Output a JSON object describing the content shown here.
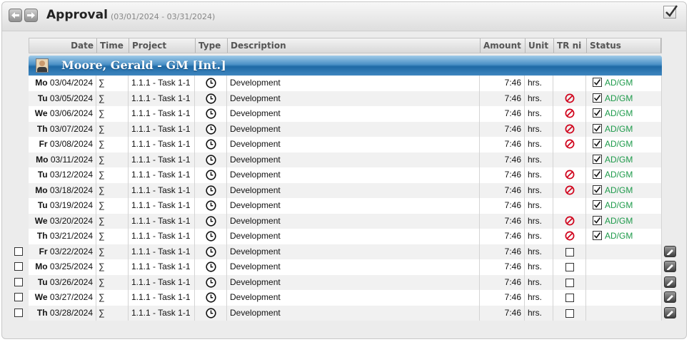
{
  "header": {
    "title": "Approval",
    "date_range": "(03/01/2024 - 03/31/2024)",
    "prev_icon": "arrow-left-icon",
    "next_icon": "arrow-right-icon",
    "approve_all_icon": "checkbox-checked-icon"
  },
  "columns": {
    "date": "Date",
    "time": "Time",
    "project": "Project",
    "type": "Type",
    "description": "Description",
    "amount": "Amount",
    "unit": "Unit",
    "tr": "TR ni",
    "status": "Status"
  },
  "employee": {
    "name": "Moore, Gerald - GM [Int.]",
    "avatar_icon": "person-avatar-icon"
  },
  "colors": {
    "status_text": "#1d9a4a",
    "no_icon": "#d0021b",
    "employee_bar": "#1f6aa6"
  },
  "rows": [
    {
      "day": "Mo",
      "date": "03/04/2024",
      "time": "∑",
      "project": "1.1.1 - Task 1-1",
      "type_icon": "clock-icon",
      "description": "Development",
      "amount": "7:46",
      "unit": "hrs.",
      "tr": "",
      "status": "AD/GM",
      "approved": true
    },
    {
      "day": "Tu",
      "date": "03/05/2024",
      "time": "∑",
      "project": "1.1.1 - Task 1-1",
      "type_icon": "clock-icon",
      "description": "Development",
      "amount": "7:46",
      "unit": "hrs.",
      "tr": "no",
      "status": "AD/GM",
      "approved": true
    },
    {
      "day": "We",
      "date": "03/06/2024",
      "time": "∑",
      "project": "1.1.1 - Task 1-1",
      "type_icon": "clock-icon",
      "description": "Development",
      "amount": "7:46",
      "unit": "hrs.",
      "tr": "no",
      "status": "AD/GM",
      "approved": true
    },
    {
      "day": "Th",
      "date": "03/07/2024",
      "time": "∑",
      "project": "1.1.1 - Task 1-1",
      "type_icon": "clock-icon",
      "description": "Development",
      "amount": "7:46",
      "unit": "hrs.",
      "tr": "no",
      "status": "AD/GM",
      "approved": true
    },
    {
      "day": "Fr",
      "date": "03/08/2024",
      "time": "∑",
      "project": "1.1.1 - Task 1-1",
      "type_icon": "clock-icon",
      "description": "Development",
      "amount": "7:46",
      "unit": "hrs.",
      "tr": "no",
      "status": "AD/GM",
      "approved": true
    },
    {
      "day": "Mo",
      "date": "03/11/2024",
      "time": "∑",
      "project": "1.1.1 - Task 1-1",
      "type_icon": "clock-icon",
      "description": "Development",
      "amount": "7:46",
      "unit": "hrs.",
      "tr": "",
      "status": "AD/GM",
      "approved": true
    },
    {
      "day": "Tu",
      "date": "03/12/2024",
      "time": "∑",
      "project": "1.1.1 - Task 1-1",
      "type_icon": "clock-icon",
      "description": "Development",
      "amount": "7:46",
      "unit": "hrs.",
      "tr": "no",
      "status": "AD/GM",
      "approved": true
    },
    {
      "day": "Mo",
      "date": "03/18/2024",
      "time": "∑",
      "project": "1.1.1 - Task 1-1",
      "type_icon": "clock-icon",
      "description": "Development",
      "amount": "7:46",
      "unit": "hrs.",
      "tr": "no",
      "status": "AD/GM",
      "approved": true
    },
    {
      "day": "Tu",
      "date": "03/19/2024",
      "time": "∑",
      "project": "1.1.1 - Task 1-1",
      "type_icon": "clock-icon",
      "description": "Development",
      "amount": "7:46",
      "unit": "hrs.",
      "tr": "",
      "status": "AD/GM",
      "approved": true
    },
    {
      "day": "We",
      "date": "03/20/2024",
      "time": "∑",
      "project": "1.1.1 - Task 1-1",
      "type_icon": "clock-icon",
      "description": "Development",
      "amount": "7:46",
      "unit": "hrs.",
      "tr": "no",
      "status": "AD/GM",
      "approved": true
    },
    {
      "day": "Th",
      "date": "03/21/2024",
      "time": "∑",
      "project": "1.1.1 - Task 1-1",
      "type_icon": "clock-icon",
      "description": "Development",
      "amount": "7:46",
      "unit": "hrs.",
      "tr": "no",
      "status": "AD/GM",
      "approved": true
    },
    {
      "day": "Fr",
      "date": "03/22/2024",
      "time": "∑",
      "project": "1.1.1 - Task 1-1",
      "type_icon": "clock-icon",
      "description": "Development",
      "amount": "7:46",
      "unit": "hrs.",
      "tr": "checkbox",
      "status": "",
      "approved": false
    },
    {
      "day": "Mo",
      "date": "03/25/2024",
      "time": "∑",
      "project": "1.1.1 - Task 1-1",
      "type_icon": "clock-icon",
      "description": "Development",
      "amount": "7:46",
      "unit": "hrs.",
      "tr": "checkbox",
      "status": "",
      "approved": false
    },
    {
      "day": "Tu",
      "date": "03/26/2024",
      "time": "∑",
      "project": "1.1.1 - Task 1-1",
      "type_icon": "clock-icon",
      "description": "Development",
      "amount": "7:46",
      "unit": "hrs.",
      "tr": "checkbox",
      "status": "",
      "approved": false
    },
    {
      "day": "We",
      "date": "03/27/2024",
      "time": "∑",
      "project": "1.1.1 - Task 1-1",
      "type_icon": "clock-icon",
      "description": "Development",
      "amount": "7:46",
      "unit": "hrs.",
      "tr": "checkbox",
      "status": "",
      "approved": false
    },
    {
      "day": "Th",
      "date": "03/28/2024",
      "time": "∑",
      "project": "1.1.1 - Task 1-1",
      "type_icon": "clock-icon",
      "description": "Development",
      "amount": "7:46",
      "unit": "hrs.",
      "tr": "checkbox",
      "status": "",
      "approved": false
    }
  ]
}
